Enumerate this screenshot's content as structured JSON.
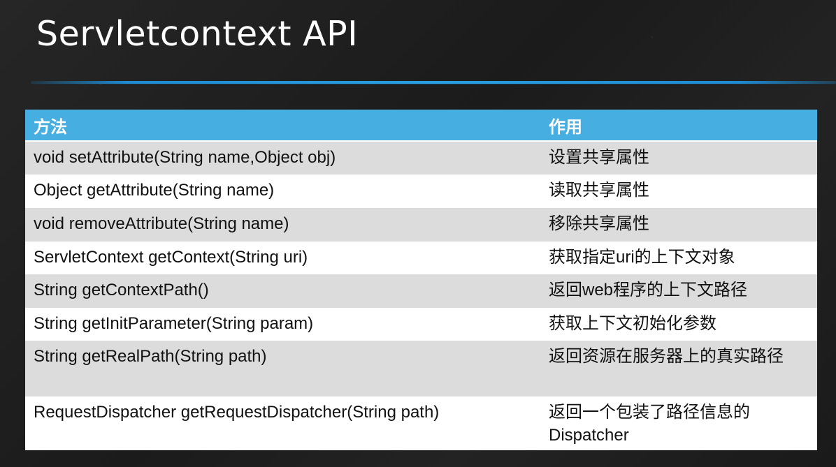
{
  "slide": {
    "title": "Servletcontext API"
  },
  "table": {
    "headers": {
      "method": "方法",
      "effect": "作用"
    },
    "rows": [
      {
        "method": "void setAttribute(String name,Object obj)",
        "effect": "设置共享属性"
      },
      {
        "method": "Object getAttribute(String name)",
        "effect": "读取共享属性"
      },
      {
        "method": "void removeAttribute(String name)",
        "effect": "移除共享属性"
      },
      {
        "method": "ServletContext getContext(String uri)",
        "effect": "获取指定uri的上下文对象"
      },
      {
        "method": "String getContextPath()",
        "effect": "返回web程序的上下文路径"
      },
      {
        "method": "String getInitParameter(String param)",
        "effect": "获取上下文初始化参数"
      },
      {
        "method": "String getRealPath(String path)",
        "effect": "返回资源在服务器上的真实路径"
      },
      {
        "method": "RequestDispatcher getRequestDispatcher(String path)",
        "effect": "返回一个包装了路径信息的Dispatcher"
      }
    ]
  },
  "colors": {
    "header_bg": "#46aee0",
    "odd_row_bg": "#dcdcdc",
    "even_row_bg": "#ffffff",
    "accent_rule": "#1f8ad0",
    "background": "#1f1f1f"
  }
}
